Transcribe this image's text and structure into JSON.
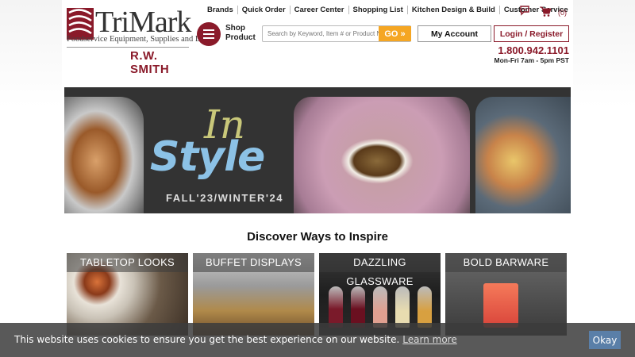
{
  "brand": {
    "name": "TriMark",
    "tagline": "Foodservice Equipment, Supplies and Design",
    "sub": "R.W. SMITH",
    "color": "#8a1a2a"
  },
  "topnav": [
    "Brands",
    "Quick Order",
    "Career Center",
    "Shopping List",
    "Kitchen Design & Build",
    "Customer Service"
  ],
  "shop": {
    "label_line1": "Shop",
    "label_line2": "Product"
  },
  "cart": {
    "count": "(0)"
  },
  "search": {
    "placeholder": "Search by Keyword, Item # or Product Name",
    "button": "GO »"
  },
  "account": {
    "my_account": "My Account",
    "login": "Login / Register"
  },
  "phone": {
    "number": "1.800.942.1101",
    "hours": "Mon-Fri 7am - 5pm PST"
  },
  "banner": {
    "in": "In",
    "style": "Style",
    "season": "FALL'23/WINTER'24"
  },
  "inspire": {
    "title": "Discover Ways to Inspire",
    "tiles": [
      "TABLETOP LOOKS",
      "BUFFET DISPLAYS",
      "DAZZLING GLASSWARE",
      "BOLD BARWARE"
    ]
  },
  "cookie": {
    "text": "This website uses cookies to ensure you get the best experience on our website.",
    "link": "Learn more",
    "button": "Okay"
  },
  "colors": {
    "accent": "#8a1a2a",
    "go": "#f5a623",
    "okay": "#5a7fa8"
  }
}
